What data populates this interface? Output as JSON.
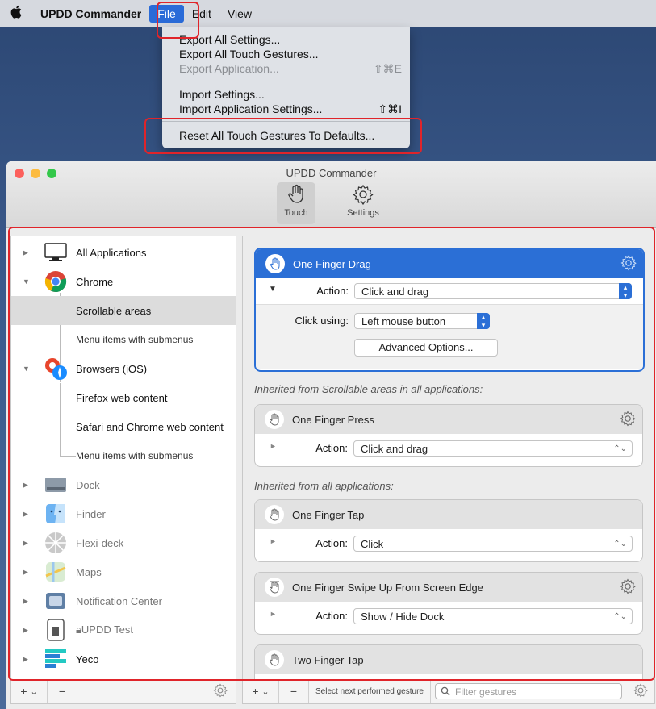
{
  "menubar": {
    "app_name": "UPDD Commander",
    "items": [
      "File",
      "Edit",
      "View"
    ]
  },
  "file_menu": {
    "items": [
      {
        "label": "Export All Settings...",
        "shortcut": "",
        "enabled": true
      },
      {
        "label": "Export All Touch Gestures...",
        "shortcut": "",
        "enabled": true
      },
      {
        "label": "Export Application...",
        "shortcut": "⇧⌘E",
        "enabled": false
      },
      {
        "label": "Import Settings...",
        "shortcut": "",
        "enabled": true
      },
      {
        "label": "Import Application Settings...",
        "shortcut": "⇧⌘I",
        "enabled": true
      },
      {
        "label": "Reset All Touch Gestures To Defaults...",
        "shortcut": "",
        "enabled": true
      }
    ]
  },
  "window": {
    "title": "UPDD Commander",
    "toolbar": {
      "touch": "Touch",
      "settings": "Settings"
    }
  },
  "sidebar": {
    "items": [
      {
        "label": "All Applications",
        "icon": "monitor-icon"
      },
      {
        "label": "Chrome",
        "icon": "chrome-icon"
      },
      {
        "label": "Scrollable areas"
      },
      {
        "label": "Menu items with submenus"
      },
      {
        "label": "Browsers (iOS)",
        "icon": "browsers-icon"
      },
      {
        "label": "Firefox web content"
      },
      {
        "label": "Safari and Chrome web content"
      },
      {
        "label": "Menu items with submenus"
      },
      {
        "label": "Dock",
        "icon": "dock-icon"
      },
      {
        "label": "Finder",
        "icon": "finder-icon"
      },
      {
        "label": "Flexi-deck",
        "icon": "flexideck-icon"
      },
      {
        "label": "Maps",
        "icon": "maps-icon"
      },
      {
        "label": "Notification Center",
        "icon": "notification-center-icon"
      },
      {
        "label": "UPDD Test",
        "icon": "updd-test-icon"
      },
      {
        "label": "Yeco",
        "icon": "yeco-icon"
      }
    ]
  },
  "gestures": {
    "active": {
      "title": "One Finger Drag",
      "action_label": "Action:",
      "action_value": "Click and drag",
      "click_using_label": "Click using:",
      "click_using_value": "Left mouse button",
      "advanced_button": "Advanced Options..."
    },
    "section1": "Inherited from Scrollable areas in all applications:",
    "press": {
      "title": "One Finger Press",
      "action_label": "Action:",
      "action_value": "Click and drag"
    },
    "section2": "Inherited from all applications:",
    "tap": {
      "title": "One Finger Tap",
      "action_label": "Action:",
      "action_value": "Click"
    },
    "swipe": {
      "title": "One Finger Swipe Up From Screen Edge",
      "action_label": "Action:",
      "action_value": "Show / Hide Dock"
    },
    "two_tap": {
      "title": "Two Finger Tap"
    }
  },
  "bottom_bar": {
    "add": "+",
    "add_chevron": "⌄",
    "remove": "−",
    "select_next": "Select next performed gesture",
    "filter_placeholder": "Filter gestures"
  }
}
